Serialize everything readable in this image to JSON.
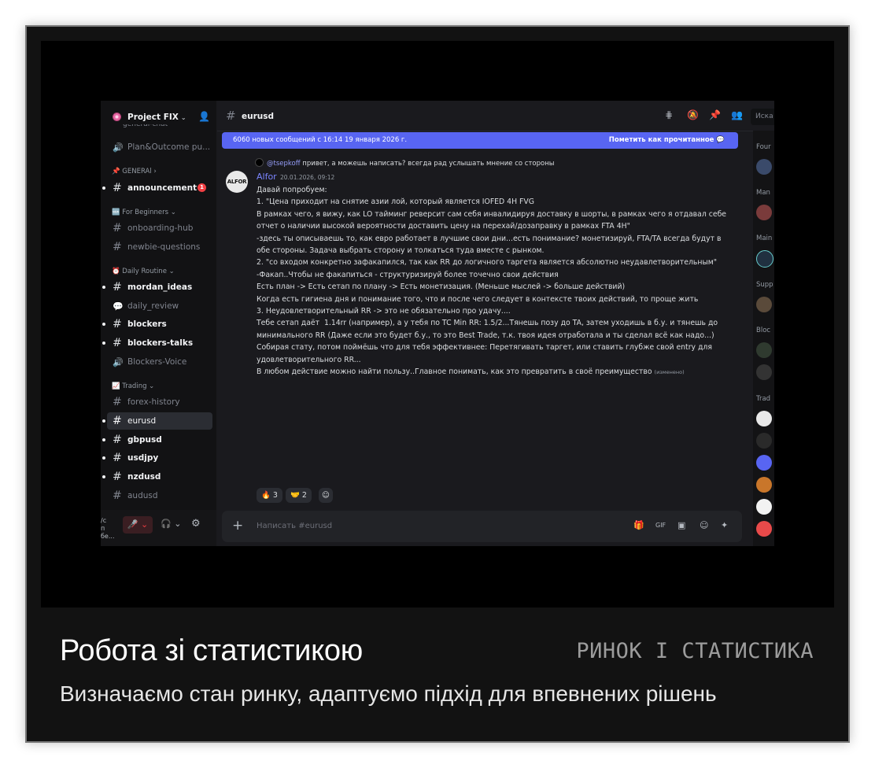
{
  "caption": {
    "title": "Робота зі статистикою",
    "tag": "РИНОК І СТАТИСТИКА",
    "subtitle": "Визначаємо стан ринку, адаптуємо підхід для впевнених рішень"
  },
  "server": {
    "name": "Project FIX"
  },
  "sidebar": {
    "clipped_channel": "general-chat",
    "items": [
      {
        "type": "voice",
        "label": "Plan&Outcome pu..."
      },
      {
        "type": "category",
        "label": "📌 GENERAl"
      },
      {
        "type": "channel",
        "label": "announcement",
        "unread": true,
        "badge": "1"
      },
      {
        "type": "category",
        "label": "🆕 For Beginners"
      },
      {
        "type": "channel",
        "label": "onboarding-hub"
      },
      {
        "type": "channel",
        "label": "newbie-questions"
      },
      {
        "type": "category",
        "label": "⏰ Daily Routine"
      },
      {
        "type": "channel",
        "label": "mordan_ideas",
        "unread": true
      },
      {
        "type": "forum",
        "label": "daily_review"
      },
      {
        "type": "channel",
        "label": "blockers",
        "unread": true
      },
      {
        "type": "channel",
        "label": "blockers-talks",
        "unread": true
      },
      {
        "type": "voice",
        "label": "Blockers-Voice"
      },
      {
        "type": "category",
        "label": "📈 Trading"
      },
      {
        "type": "channel",
        "label": "forex-history"
      },
      {
        "type": "channel",
        "label": "eurusd",
        "active": true
      },
      {
        "type": "channel",
        "label": "gbpusd",
        "unread": true
      },
      {
        "type": "channel",
        "label": "usdjpy",
        "unread": true
      },
      {
        "type": "channel",
        "label": "nzdusd",
        "unread": true
      },
      {
        "type": "channel",
        "label": "audusd"
      }
    ]
  },
  "userbar": {
    "line1": "/c",
    "line2": "п бе..."
  },
  "channel": {
    "name": "eurusd",
    "search_placeholder": "Иска"
  },
  "new_messages": {
    "text": "6060 новых сообщений с 16:14 19 января 2026 г.",
    "action": "Пометить как прочитанное"
  },
  "reply": {
    "mention": "@tsepkoff",
    "text": "привет,  а можешь написать?  всегда рад услышать мнение со стороны"
  },
  "message": {
    "avatar": "ALFOR",
    "author": "Alfor",
    "timestamp": "20.01.2026, 09:12",
    "lines": [
      "Давай попробуем:",
      "",
      "1. \"Цена приходит на снятие азии лой, который является IOFED 4H FVG",
      "",
      "В рамках чего, я вижу, как LO тайминг реверсит сам себя инвалидируя доставку в шорты, в рамках чего я отдавал себе",
      "отчет о наличии высокой вероятности доставить цену на перехай/дозаправку в рамках FTA 4H\"",
      "",
      "-здесь ты описываешь то, как евро работает в лучшие свои дни...есть понимание? монетизируй, FTA/TA всегда будут в",
      "обе стороны. Задача выбрать сторону и толкаться туда вместе с рынком.",
      "",
      "2. \"со входом конкретно зафакапился, так как RR до логичного таргета является абсолютно неудавлетворительным\"",
      "",
      "-Факап..Чтобы не факапиться - структуризируй более точечно свои действия",
      "Есть план -> Есть сетап по плану -> Есть монетизация. (Меньше мыслей -> больше действий)",
      "",
      "Когда есть гигиена дня и понимание того, что и после чего следует в контексте твоих действий, то проще жить",
      "",
      "3. Неудовлетворительный RR -> это не обязательно про удачу....",
      "Тебе сетап даёт  1.14rr (например), а у тебя по TC Min RR: 1.5/2...Тянешь позу до TA, затем уходишь в б.у. и тянешь до",
      "минимального RR (Даже если это будет б.у., то это Best Trade, т.к. твоя идея отработала и ты сделал всё как надо...)",
      "Собирая стату, потом поймёшь что для тебя эффективнее: Перетягивать таргет, или ставить глубже свой entry для",
      "удовлетворительного RR...",
      "",
      "В любом действие можно найти пользу..Главное понимать, как это превратить в своё преимущество"
    ],
    "edited": "(изменено)"
  },
  "reactions": [
    {
      "emoji": "🔥",
      "count": "3"
    },
    {
      "emoji": "🤝",
      "count": "2"
    }
  ],
  "composer": {
    "placeholder": "Написать #eurusd"
  },
  "members": {
    "groups": [
      "Four",
      "Man",
      "Main",
      "Supp",
      "Bloc",
      "Trad"
    ]
  }
}
